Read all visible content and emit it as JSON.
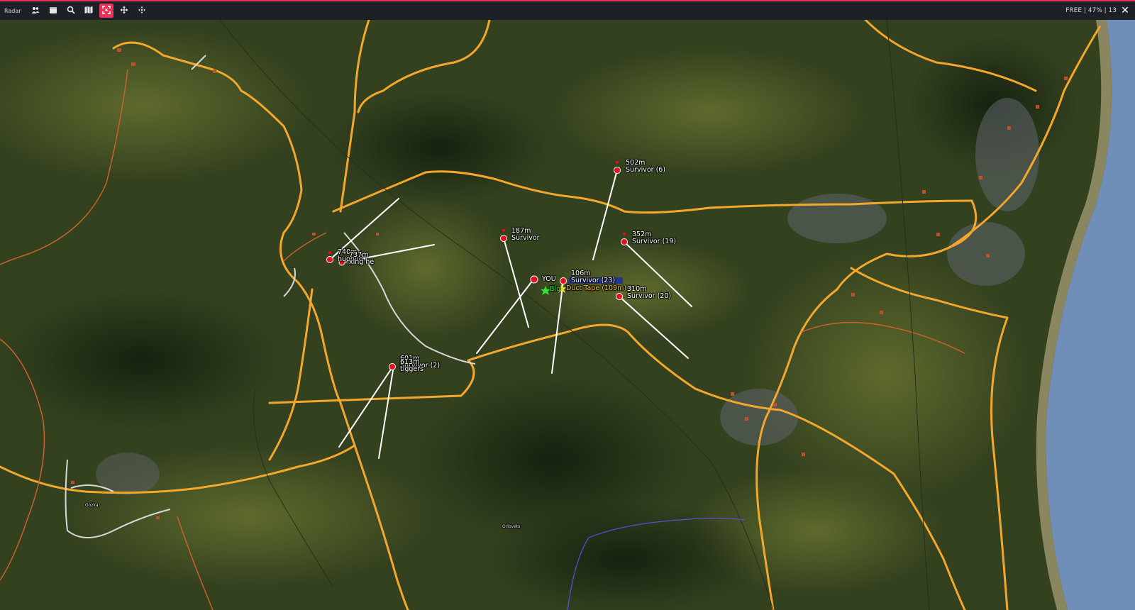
{
  "app": {
    "title": "Radar"
  },
  "toolbar": {
    "buttons": [
      {
        "icon": "players-icon"
      },
      {
        "icon": "calendar-icon"
      },
      {
        "icon": "search-icon"
      },
      {
        "icon": "map-icon"
      },
      {
        "icon": "fullscreen-icon",
        "active": true
      },
      {
        "icon": "move-icon"
      },
      {
        "icon": "center-icon"
      }
    ],
    "status": "FREE | 47% | 13",
    "close_label": "✕"
  },
  "colors": {
    "accent": "#e8325a",
    "road": "#f3a72c",
    "player": "#e10f1f",
    "water": "#6f8fb8"
  },
  "player": {
    "label": "YOU"
  },
  "entities": [
    {
      "distance": "502m",
      "name": "Survivor (6)"
    },
    {
      "distance": "187m",
      "name": "Survivor"
    },
    {
      "distance": "352m",
      "name": "Survivor (19)"
    },
    {
      "distance": "106m",
      "name": "Survivor (23)"
    },
    {
      "distance": "310m",
      "name": "Survivor (20)"
    },
    {
      "distance": "740m",
      "name": "huohuo"
    },
    {
      "distance": "737m",
      "name": "xing he"
    },
    {
      "distance": "601m",
      "name": "Survivor (2)"
    },
    {
      "distance": "613m",
      "name": "tiggers"
    }
  ],
  "loot": [
    {
      "label": "Blo"
    },
    {
      "label": "Duct Tape (109m)"
    }
  ],
  "places": [
    "Gozka",
    "Orlovets"
  ]
}
